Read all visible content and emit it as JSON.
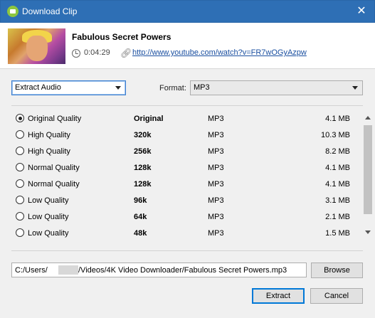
{
  "window": {
    "title": "Download Clip",
    "close_glyph": "✕"
  },
  "clip": {
    "title": "Fabulous Secret Powers",
    "duration": "0:04:29",
    "url": "http://www.youtube.com/watch?v=FR7wOGyAzpw"
  },
  "mode_select": {
    "value": "Extract Audio"
  },
  "format": {
    "label": "Format:",
    "value": "MP3"
  },
  "qualities": [
    {
      "name": "Original Quality",
      "bitrate": "Original",
      "format": "MP3",
      "size": "4.1 MB",
      "selected": true
    },
    {
      "name": "High Quality",
      "bitrate": "320k",
      "format": "MP3",
      "size": "10.3 MB",
      "selected": false
    },
    {
      "name": "High Quality",
      "bitrate": "256k",
      "format": "MP3",
      "size": "8.2 MB",
      "selected": false
    },
    {
      "name": "Normal Quality",
      "bitrate": "128k",
      "format": "MP3",
      "size": "4.1 MB",
      "selected": false
    },
    {
      "name": "Normal Quality",
      "bitrate": "128k",
      "format": "MP3",
      "size": "4.1 MB",
      "selected": false
    },
    {
      "name": "Low Quality",
      "bitrate": "96k",
      "format": "MP3",
      "size": "3.1 MB",
      "selected": false
    },
    {
      "name": "Low Quality",
      "bitrate": "64k",
      "format": "MP3",
      "size": "2.1 MB",
      "selected": false
    },
    {
      "name": "Low Quality",
      "bitrate": "48k",
      "format": "MP3",
      "size": "1.5 MB",
      "selected": false
    }
  ],
  "save_path": {
    "prefix": "C:/Users/",
    "suffix": "/Videos/4K Video Downloader/Fabulous Secret Powers.mp3"
  },
  "buttons": {
    "browse": "Browse",
    "extract": "Extract",
    "cancel": "Cancel"
  },
  "icons": {
    "app": "app-logo-icon",
    "clock": "clock-icon",
    "link": "link-icon"
  },
  "colors": {
    "titlebar": "#2e6fb5",
    "link": "#1a4fa0",
    "accent": "#0078d7"
  }
}
